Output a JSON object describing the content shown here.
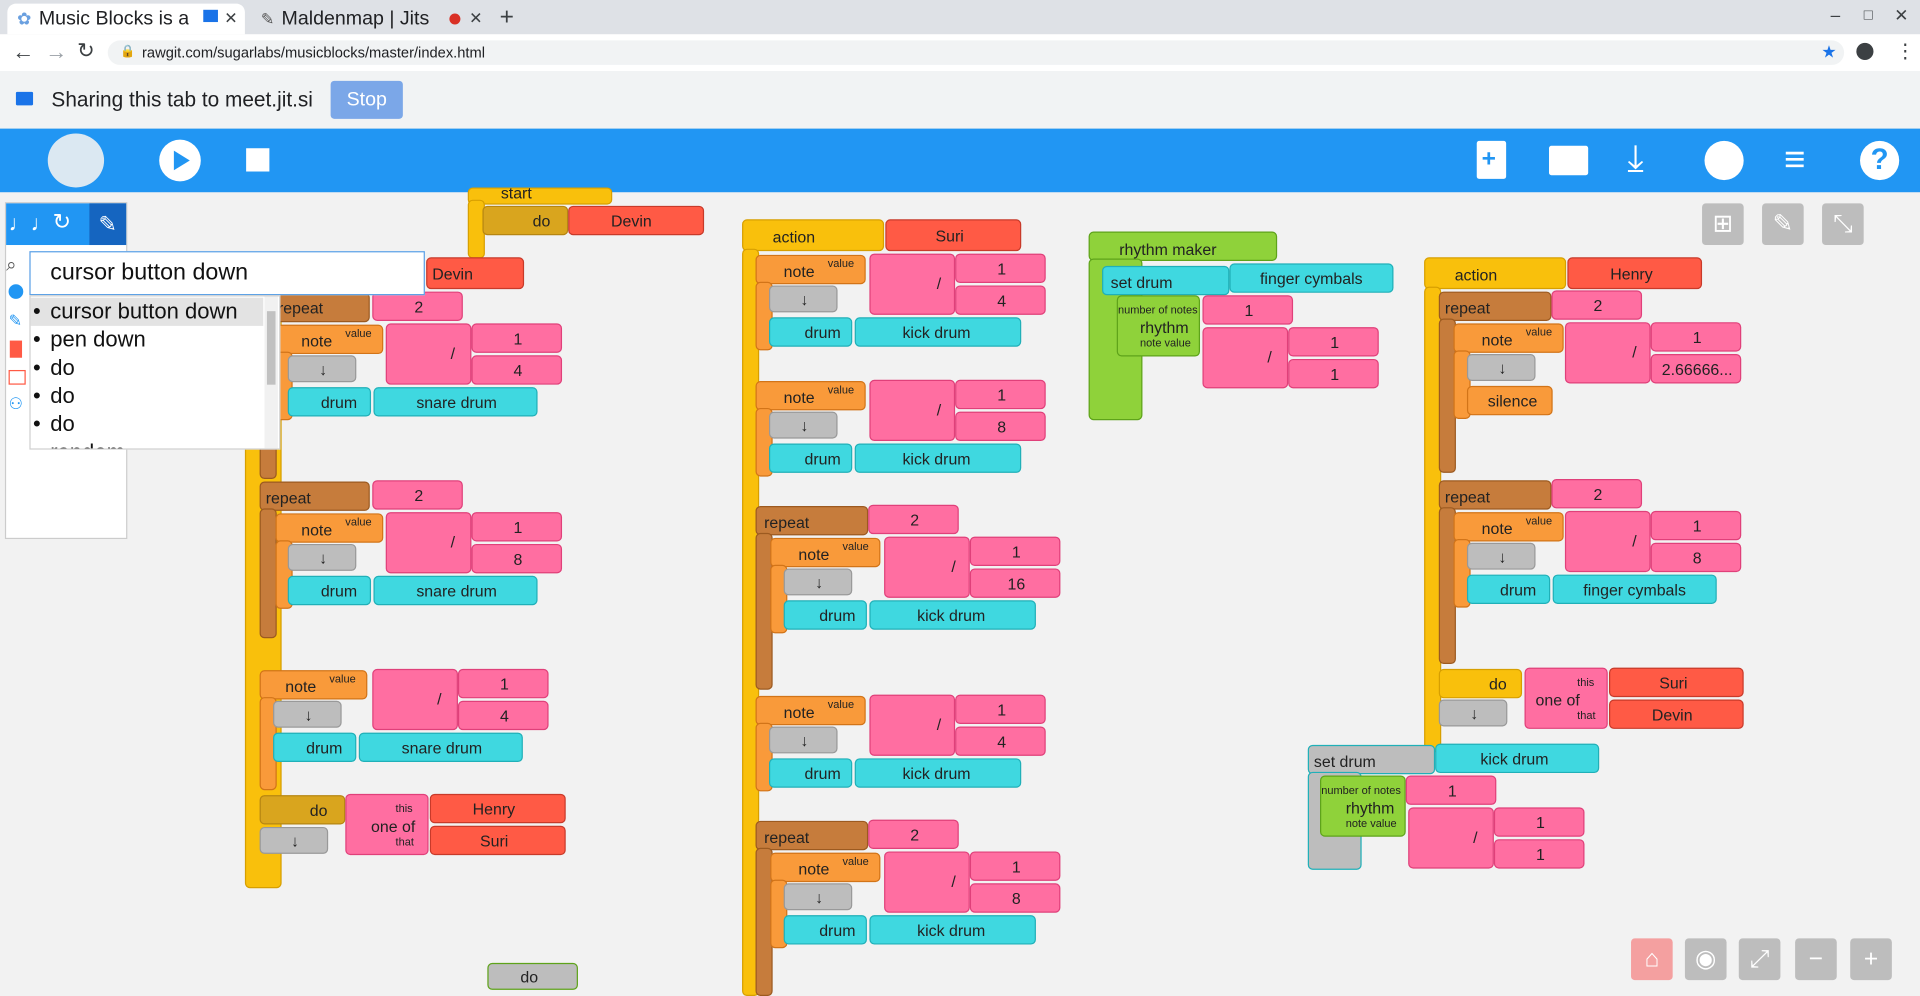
{
  "browser": {
    "tabs": [
      {
        "title": "Music Blocks is a"
      },
      {
        "title": "Maldenmap | Jits"
      }
    ],
    "url": "rawgit.com/sugarlabs/musicblocks/master/index.html",
    "share_text": "Sharing this tab to meet.jit.si",
    "stop_label": "Stop"
  },
  "toolbar": {
    "icons": [
      "mouse-logo-icon",
      "play-icon",
      "stop-icon",
      "new-project-icon",
      "folder-icon",
      "download-icon",
      "globe-icon",
      "menu-icon",
      "help-icon"
    ]
  },
  "search": {
    "value": "cursor button down",
    "suggestions": [
      "cursor button down",
      "pen down",
      "do",
      "do",
      "do",
      "random"
    ]
  },
  "blocks": {
    "start": "start",
    "do": "do",
    "repeat": "repeat",
    "note": "note",
    "value": "value",
    "drum": "drum",
    "action": "action",
    "rhythm_maker": "rhythm maker",
    "set_drum": "set drum",
    "rhythm": "rhythm",
    "number_of_notes": "number of notes",
    "note_value": "note value",
    "silence": "silence",
    "one_of": "one of",
    "this": "this",
    "that": "that",
    "arrow": "↓",
    "slash": "/",
    "names": {
      "devin": "Devin",
      "suri": "Suri",
      "henry": "Henry"
    },
    "drums": {
      "snare": "snare drum",
      "kick": "kick drum",
      "finger": "finger cymbals"
    },
    "nums": {
      "one": "1",
      "two": "2",
      "four": "4",
      "eight": "8",
      "sixteen": "16",
      "two_six": "2.66666..."
    }
  }
}
